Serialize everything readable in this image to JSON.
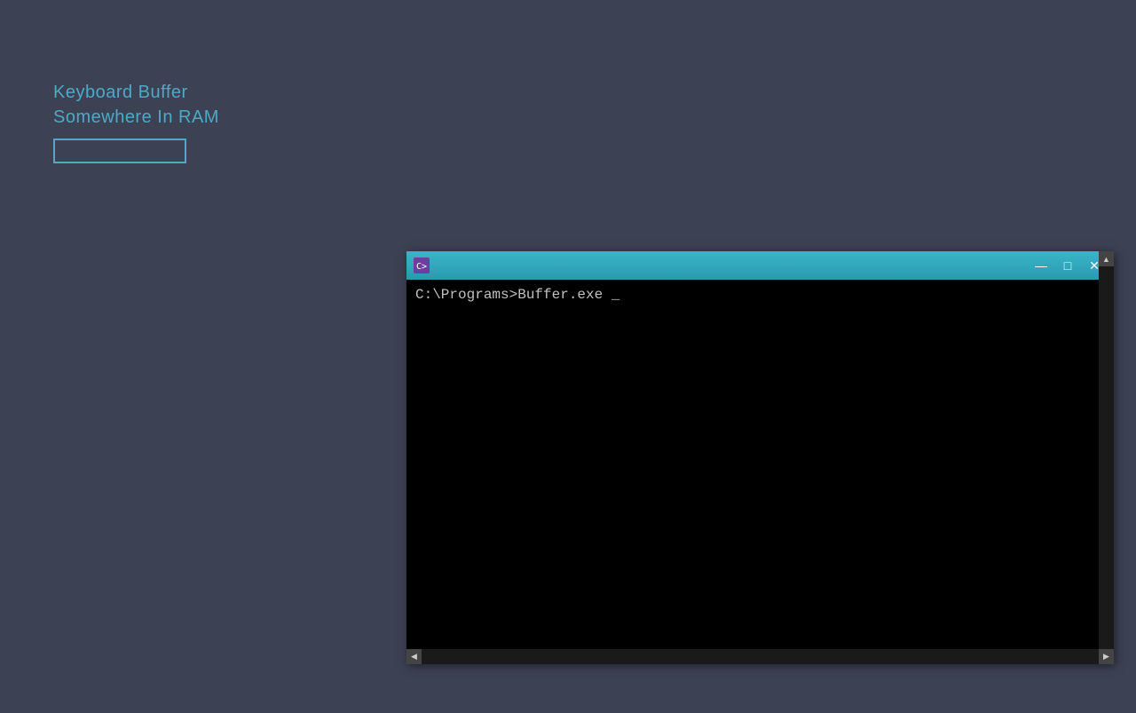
{
  "background": {
    "color": "#3c4254"
  },
  "top_left": {
    "keyboard_buffer_label": "Keyboard Buffer",
    "somewhere_ram_label": "Somewhere In RAM"
  },
  "console": {
    "title": "",
    "command_text": "C:\\Programs>Buffer.exe _",
    "minimize_label": "—",
    "maximize_label": "□",
    "close_label": "✕"
  }
}
